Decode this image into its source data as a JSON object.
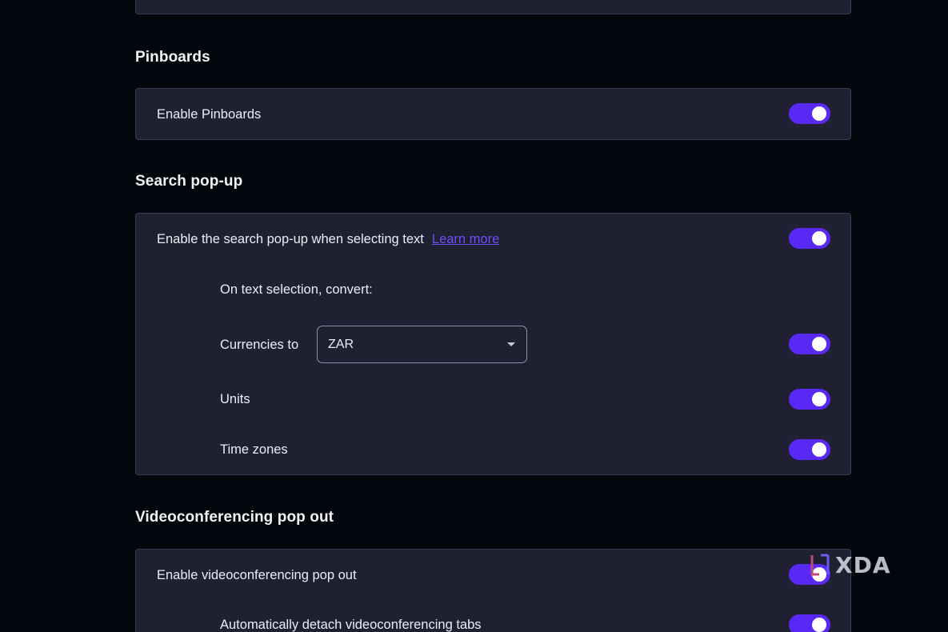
{
  "sections": {
    "pinboards": {
      "title": "Pinboards",
      "enable_label": "Enable Pinboards",
      "enabled": true
    },
    "search_popup": {
      "title": "Search pop-up",
      "enable_label": "Enable the search pop-up when selecting text",
      "learn_more": "Learn more",
      "enabled": true,
      "convert_heading": "On text selection, convert:",
      "currencies_label": "Currencies to",
      "currency_value": "ZAR",
      "currencies_enabled": true,
      "units_label": "Units",
      "units_enabled": true,
      "timezones_label": "Time zones",
      "timezones_enabled": true
    },
    "videoconferencing": {
      "title": "Videoconferencing pop out",
      "enable_label": "Enable videoconferencing pop out",
      "enabled": true,
      "detach_label": "Automatically detach videoconferencing tabs",
      "detach_enabled": true
    }
  },
  "watermark": {
    "text": "XDA"
  },
  "colors": {
    "background": "#03050d",
    "card": "#1f2032",
    "toggle_on": "#5a28f5",
    "link": "#6f4ef7"
  }
}
